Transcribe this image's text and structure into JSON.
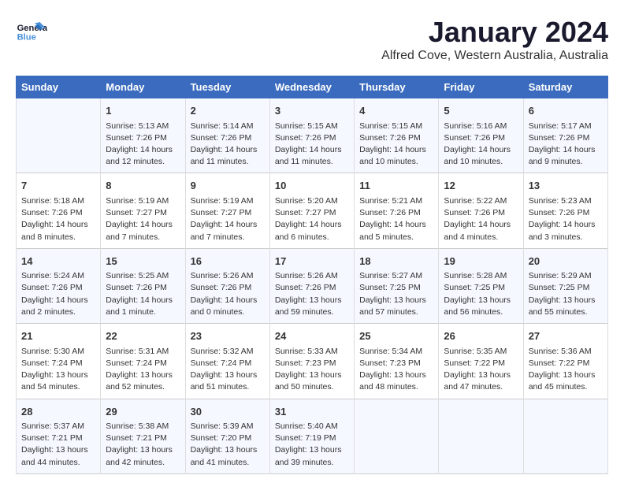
{
  "header": {
    "logo_general": "General",
    "logo_blue": "Blue",
    "month_title": "January 2024",
    "location": "Alfred Cove, Western Australia, Australia"
  },
  "weekdays": [
    "Sunday",
    "Monday",
    "Tuesday",
    "Wednesday",
    "Thursday",
    "Friday",
    "Saturday"
  ],
  "weeks": [
    [
      {
        "day": "",
        "info": ""
      },
      {
        "day": "1",
        "info": "Sunrise: 5:13 AM\nSunset: 7:26 PM\nDaylight: 14 hours\nand 12 minutes."
      },
      {
        "day": "2",
        "info": "Sunrise: 5:14 AM\nSunset: 7:26 PM\nDaylight: 14 hours\nand 11 minutes."
      },
      {
        "day": "3",
        "info": "Sunrise: 5:15 AM\nSunset: 7:26 PM\nDaylight: 14 hours\nand 11 minutes."
      },
      {
        "day": "4",
        "info": "Sunrise: 5:15 AM\nSunset: 7:26 PM\nDaylight: 14 hours\nand 10 minutes."
      },
      {
        "day": "5",
        "info": "Sunrise: 5:16 AM\nSunset: 7:26 PM\nDaylight: 14 hours\nand 10 minutes."
      },
      {
        "day": "6",
        "info": "Sunrise: 5:17 AM\nSunset: 7:26 PM\nDaylight: 14 hours\nand 9 minutes."
      }
    ],
    [
      {
        "day": "7",
        "info": "Sunrise: 5:18 AM\nSunset: 7:26 PM\nDaylight: 14 hours\nand 8 minutes."
      },
      {
        "day": "8",
        "info": "Sunrise: 5:19 AM\nSunset: 7:27 PM\nDaylight: 14 hours\nand 7 minutes."
      },
      {
        "day": "9",
        "info": "Sunrise: 5:19 AM\nSunset: 7:27 PM\nDaylight: 14 hours\nand 7 minutes."
      },
      {
        "day": "10",
        "info": "Sunrise: 5:20 AM\nSunset: 7:27 PM\nDaylight: 14 hours\nand 6 minutes."
      },
      {
        "day": "11",
        "info": "Sunrise: 5:21 AM\nSunset: 7:26 PM\nDaylight: 14 hours\nand 5 minutes."
      },
      {
        "day": "12",
        "info": "Sunrise: 5:22 AM\nSunset: 7:26 PM\nDaylight: 14 hours\nand 4 minutes."
      },
      {
        "day": "13",
        "info": "Sunrise: 5:23 AM\nSunset: 7:26 PM\nDaylight: 14 hours\nand 3 minutes."
      }
    ],
    [
      {
        "day": "14",
        "info": "Sunrise: 5:24 AM\nSunset: 7:26 PM\nDaylight: 14 hours\nand 2 minutes."
      },
      {
        "day": "15",
        "info": "Sunrise: 5:25 AM\nSunset: 7:26 PM\nDaylight: 14 hours\nand 1 minute."
      },
      {
        "day": "16",
        "info": "Sunrise: 5:26 AM\nSunset: 7:26 PM\nDaylight: 14 hours\nand 0 minutes."
      },
      {
        "day": "17",
        "info": "Sunrise: 5:26 AM\nSunset: 7:26 PM\nDaylight: 13 hours\nand 59 minutes."
      },
      {
        "day": "18",
        "info": "Sunrise: 5:27 AM\nSunset: 7:25 PM\nDaylight: 13 hours\nand 57 minutes."
      },
      {
        "day": "19",
        "info": "Sunrise: 5:28 AM\nSunset: 7:25 PM\nDaylight: 13 hours\nand 56 minutes."
      },
      {
        "day": "20",
        "info": "Sunrise: 5:29 AM\nSunset: 7:25 PM\nDaylight: 13 hours\nand 55 minutes."
      }
    ],
    [
      {
        "day": "21",
        "info": "Sunrise: 5:30 AM\nSunset: 7:24 PM\nDaylight: 13 hours\nand 54 minutes."
      },
      {
        "day": "22",
        "info": "Sunrise: 5:31 AM\nSunset: 7:24 PM\nDaylight: 13 hours\nand 52 minutes."
      },
      {
        "day": "23",
        "info": "Sunrise: 5:32 AM\nSunset: 7:24 PM\nDaylight: 13 hours\nand 51 minutes."
      },
      {
        "day": "24",
        "info": "Sunrise: 5:33 AM\nSunset: 7:23 PM\nDaylight: 13 hours\nand 50 minutes."
      },
      {
        "day": "25",
        "info": "Sunrise: 5:34 AM\nSunset: 7:23 PM\nDaylight: 13 hours\nand 48 minutes."
      },
      {
        "day": "26",
        "info": "Sunrise: 5:35 AM\nSunset: 7:22 PM\nDaylight: 13 hours\nand 47 minutes."
      },
      {
        "day": "27",
        "info": "Sunrise: 5:36 AM\nSunset: 7:22 PM\nDaylight: 13 hours\nand 45 minutes."
      }
    ],
    [
      {
        "day": "28",
        "info": "Sunrise: 5:37 AM\nSunset: 7:21 PM\nDaylight: 13 hours\nand 44 minutes."
      },
      {
        "day": "29",
        "info": "Sunrise: 5:38 AM\nSunset: 7:21 PM\nDaylight: 13 hours\nand 42 minutes."
      },
      {
        "day": "30",
        "info": "Sunrise: 5:39 AM\nSunset: 7:20 PM\nDaylight: 13 hours\nand 41 minutes."
      },
      {
        "day": "31",
        "info": "Sunrise: 5:40 AM\nSunset: 7:19 PM\nDaylight: 13 hours\nand 39 minutes."
      },
      {
        "day": "",
        "info": ""
      },
      {
        "day": "",
        "info": ""
      },
      {
        "day": "",
        "info": ""
      }
    ]
  ]
}
